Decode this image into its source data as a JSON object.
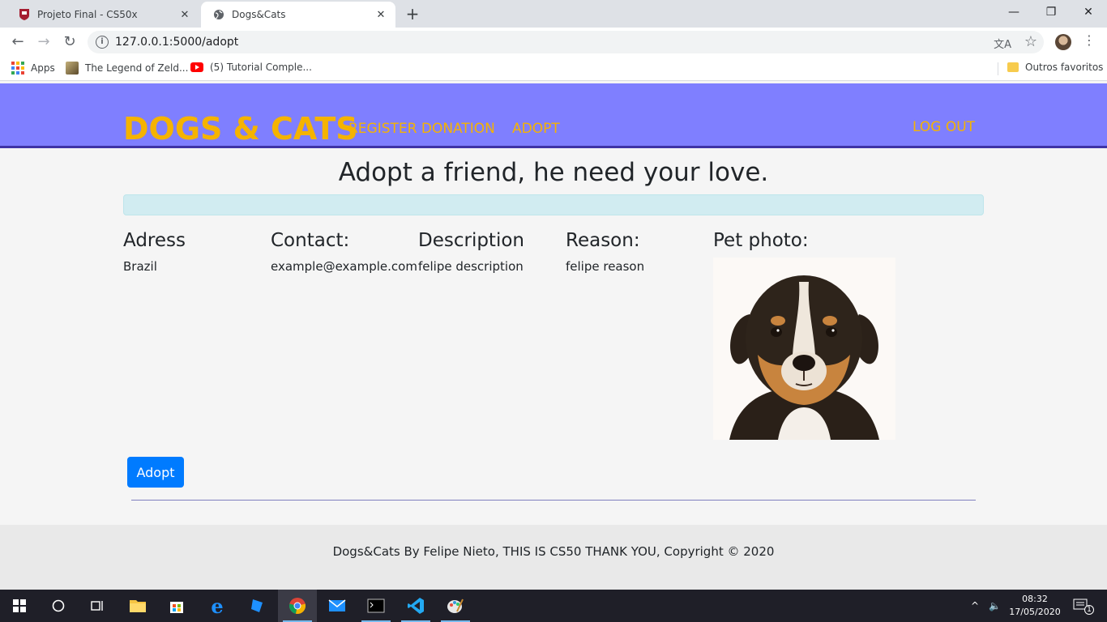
{
  "browser": {
    "tabs": [
      {
        "title": "Projeto Final - CS50x",
        "active": false
      },
      {
        "title": "Dogs&Cats",
        "active": true
      }
    ],
    "url": "127.0.0.1:5000/adopt",
    "bookmarks": [
      {
        "label": "Apps"
      },
      {
        "label": "The Legend of Zeld..."
      },
      {
        "label": "(5) Tutorial Comple..."
      }
    ],
    "other_bookmarks": "Outros favoritos"
  },
  "nav": {
    "brand": "DOGS & CATS",
    "links": [
      "REGISTER DONATION",
      "ADOPT"
    ],
    "logout": "LOG OUT"
  },
  "page": {
    "title": "Adopt a friend, he need your love.",
    "columns": [
      {
        "heading": "Adress",
        "value": "Brazil"
      },
      {
        "heading": "Contact:",
        "value": "example@example.com"
      },
      {
        "heading": "Description",
        "value": "felipe description"
      },
      {
        "heading": "Reason:",
        "value": "felipe reason"
      },
      {
        "heading": "Pet photo:"
      }
    ],
    "adopt_button": "Adopt"
  },
  "footer": {
    "text": "Dogs&Cats By Felipe Nieto, THIS IS CS50 THANK YOU, Copyright © 2020"
  },
  "taskbar": {
    "time": "08:32",
    "date": "17/05/2020",
    "notification_count": "1"
  },
  "colors": {
    "nav_bg": "#7f7fff",
    "brand": "#f5b300",
    "button": "#007bff",
    "alert_bg": "#d1ecf1"
  }
}
